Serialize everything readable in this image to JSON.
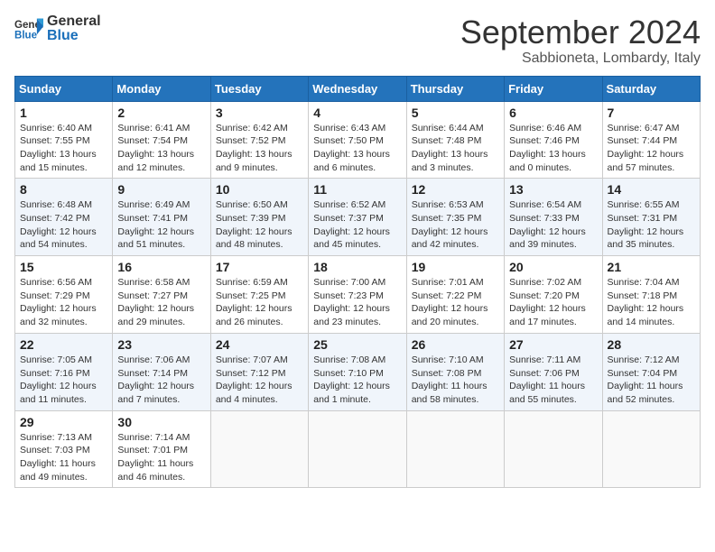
{
  "header": {
    "logo_general": "General",
    "logo_blue": "Blue",
    "month_year": "September 2024",
    "location": "Sabbioneta, Lombardy, Italy"
  },
  "days_of_week": [
    "Sunday",
    "Monday",
    "Tuesday",
    "Wednesday",
    "Thursday",
    "Friday",
    "Saturday"
  ],
  "weeks": [
    [
      {
        "day": "1",
        "detail": "Sunrise: 6:40 AM\nSunset: 7:55 PM\nDaylight: 13 hours\nand 15 minutes."
      },
      {
        "day": "2",
        "detail": "Sunrise: 6:41 AM\nSunset: 7:54 PM\nDaylight: 13 hours\nand 12 minutes."
      },
      {
        "day": "3",
        "detail": "Sunrise: 6:42 AM\nSunset: 7:52 PM\nDaylight: 13 hours\nand 9 minutes."
      },
      {
        "day": "4",
        "detail": "Sunrise: 6:43 AM\nSunset: 7:50 PM\nDaylight: 13 hours\nand 6 minutes."
      },
      {
        "day": "5",
        "detail": "Sunrise: 6:44 AM\nSunset: 7:48 PM\nDaylight: 13 hours\nand 3 minutes."
      },
      {
        "day": "6",
        "detail": "Sunrise: 6:46 AM\nSunset: 7:46 PM\nDaylight: 13 hours\nand 0 minutes."
      },
      {
        "day": "7",
        "detail": "Sunrise: 6:47 AM\nSunset: 7:44 PM\nDaylight: 12 hours\nand 57 minutes."
      }
    ],
    [
      {
        "day": "8",
        "detail": "Sunrise: 6:48 AM\nSunset: 7:42 PM\nDaylight: 12 hours\nand 54 minutes."
      },
      {
        "day": "9",
        "detail": "Sunrise: 6:49 AM\nSunset: 7:41 PM\nDaylight: 12 hours\nand 51 minutes."
      },
      {
        "day": "10",
        "detail": "Sunrise: 6:50 AM\nSunset: 7:39 PM\nDaylight: 12 hours\nand 48 minutes."
      },
      {
        "day": "11",
        "detail": "Sunrise: 6:52 AM\nSunset: 7:37 PM\nDaylight: 12 hours\nand 45 minutes."
      },
      {
        "day": "12",
        "detail": "Sunrise: 6:53 AM\nSunset: 7:35 PM\nDaylight: 12 hours\nand 42 minutes."
      },
      {
        "day": "13",
        "detail": "Sunrise: 6:54 AM\nSunset: 7:33 PM\nDaylight: 12 hours\nand 39 minutes."
      },
      {
        "day": "14",
        "detail": "Sunrise: 6:55 AM\nSunset: 7:31 PM\nDaylight: 12 hours\nand 35 minutes."
      }
    ],
    [
      {
        "day": "15",
        "detail": "Sunrise: 6:56 AM\nSunset: 7:29 PM\nDaylight: 12 hours\nand 32 minutes."
      },
      {
        "day": "16",
        "detail": "Sunrise: 6:58 AM\nSunset: 7:27 PM\nDaylight: 12 hours\nand 29 minutes."
      },
      {
        "day": "17",
        "detail": "Sunrise: 6:59 AM\nSunset: 7:25 PM\nDaylight: 12 hours\nand 26 minutes."
      },
      {
        "day": "18",
        "detail": "Sunrise: 7:00 AM\nSunset: 7:23 PM\nDaylight: 12 hours\nand 23 minutes."
      },
      {
        "day": "19",
        "detail": "Sunrise: 7:01 AM\nSunset: 7:22 PM\nDaylight: 12 hours\nand 20 minutes."
      },
      {
        "day": "20",
        "detail": "Sunrise: 7:02 AM\nSunset: 7:20 PM\nDaylight: 12 hours\nand 17 minutes."
      },
      {
        "day": "21",
        "detail": "Sunrise: 7:04 AM\nSunset: 7:18 PM\nDaylight: 12 hours\nand 14 minutes."
      }
    ],
    [
      {
        "day": "22",
        "detail": "Sunrise: 7:05 AM\nSunset: 7:16 PM\nDaylight: 12 hours\nand 11 minutes."
      },
      {
        "day": "23",
        "detail": "Sunrise: 7:06 AM\nSunset: 7:14 PM\nDaylight: 12 hours\nand 7 minutes."
      },
      {
        "day": "24",
        "detail": "Sunrise: 7:07 AM\nSunset: 7:12 PM\nDaylight: 12 hours\nand 4 minutes."
      },
      {
        "day": "25",
        "detail": "Sunrise: 7:08 AM\nSunset: 7:10 PM\nDaylight: 12 hours\nand 1 minute."
      },
      {
        "day": "26",
        "detail": "Sunrise: 7:10 AM\nSunset: 7:08 PM\nDaylight: 11 hours\nand 58 minutes."
      },
      {
        "day": "27",
        "detail": "Sunrise: 7:11 AM\nSunset: 7:06 PM\nDaylight: 11 hours\nand 55 minutes."
      },
      {
        "day": "28",
        "detail": "Sunrise: 7:12 AM\nSunset: 7:04 PM\nDaylight: 11 hours\nand 52 minutes."
      }
    ],
    [
      {
        "day": "29",
        "detail": "Sunrise: 7:13 AM\nSunset: 7:03 PM\nDaylight: 11 hours\nand 49 minutes."
      },
      {
        "day": "30",
        "detail": "Sunrise: 7:14 AM\nSunset: 7:01 PM\nDaylight: 11 hours\nand 46 minutes."
      },
      {
        "day": "",
        "detail": ""
      },
      {
        "day": "",
        "detail": ""
      },
      {
        "day": "",
        "detail": ""
      },
      {
        "day": "",
        "detail": ""
      },
      {
        "day": "",
        "detail": ""
      }
    ]
  ]
}
